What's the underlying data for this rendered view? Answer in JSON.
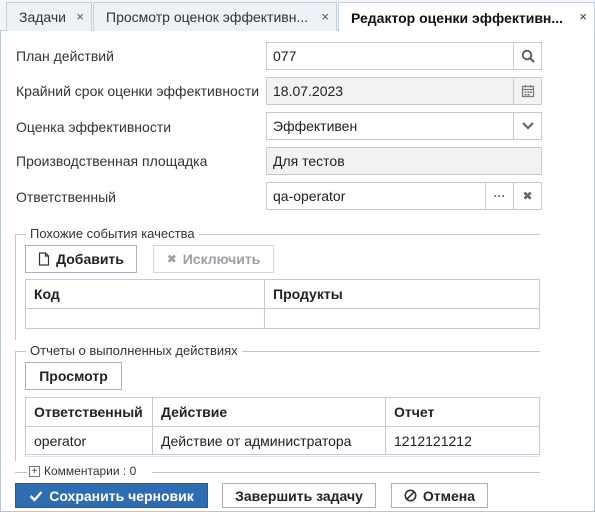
{
  "tabs": [
    {
      "label": "Задачи",
      "close": "×"
    },
    {
      "label": "Просмотр оценок эффективн...",
      "close": "×"
    },
    {
      "label": "Редактор оценки эффективн...",
      "close": "×"
    }
  ],
  "form": {
    "action_plan": {
      "label": "План действий",
      "value": "077",
      "icon": "search-icon"
    },
    "deadline": {
      "label": "Крайний срок оценки эффективности",
      "value": "18.07.2023",
      "icon": "calendar-icon"
    },
    "evaluation": {
      "label": "Оценка эффективности",
      "value": "Эффективен",
      "icon": "chevron-down-icon"
    },
    "site": {
      "label": "Производственная площадка",
      "value": "Для тестов"
    },
    "responsible": {
      "label": "Ответственный",
      "value": "qa-operator",
      "more": "···",
      "clear": "✖"
    }
  },
  "similar_events": {
    "title": "Похожие события качества",
    "add_label": "Добавить",
    "exclude_label": "Исключить",
    "columns": [
      "Код",
      "Продукты"
    ]
  },
  "reports": {
    "title": "Отчеты о выполненных действиях",
    "view_label": "Просмотр",
    "columns": [
      "Ответственный",
      "Действие",
      "Отчет"
    ],
    "rows": [
      [
        "operator",
        "Действие от администратора",
        "1212121212"
      ]
    ]
  },
  "comments": {
    "label": "Комментарии : 0"
  },
  "footer": {
    "save_draft": "Сохранить черновик",
    "finish_task": "Завершить задачу",
    "cancel": "Отмена"
  }
}
